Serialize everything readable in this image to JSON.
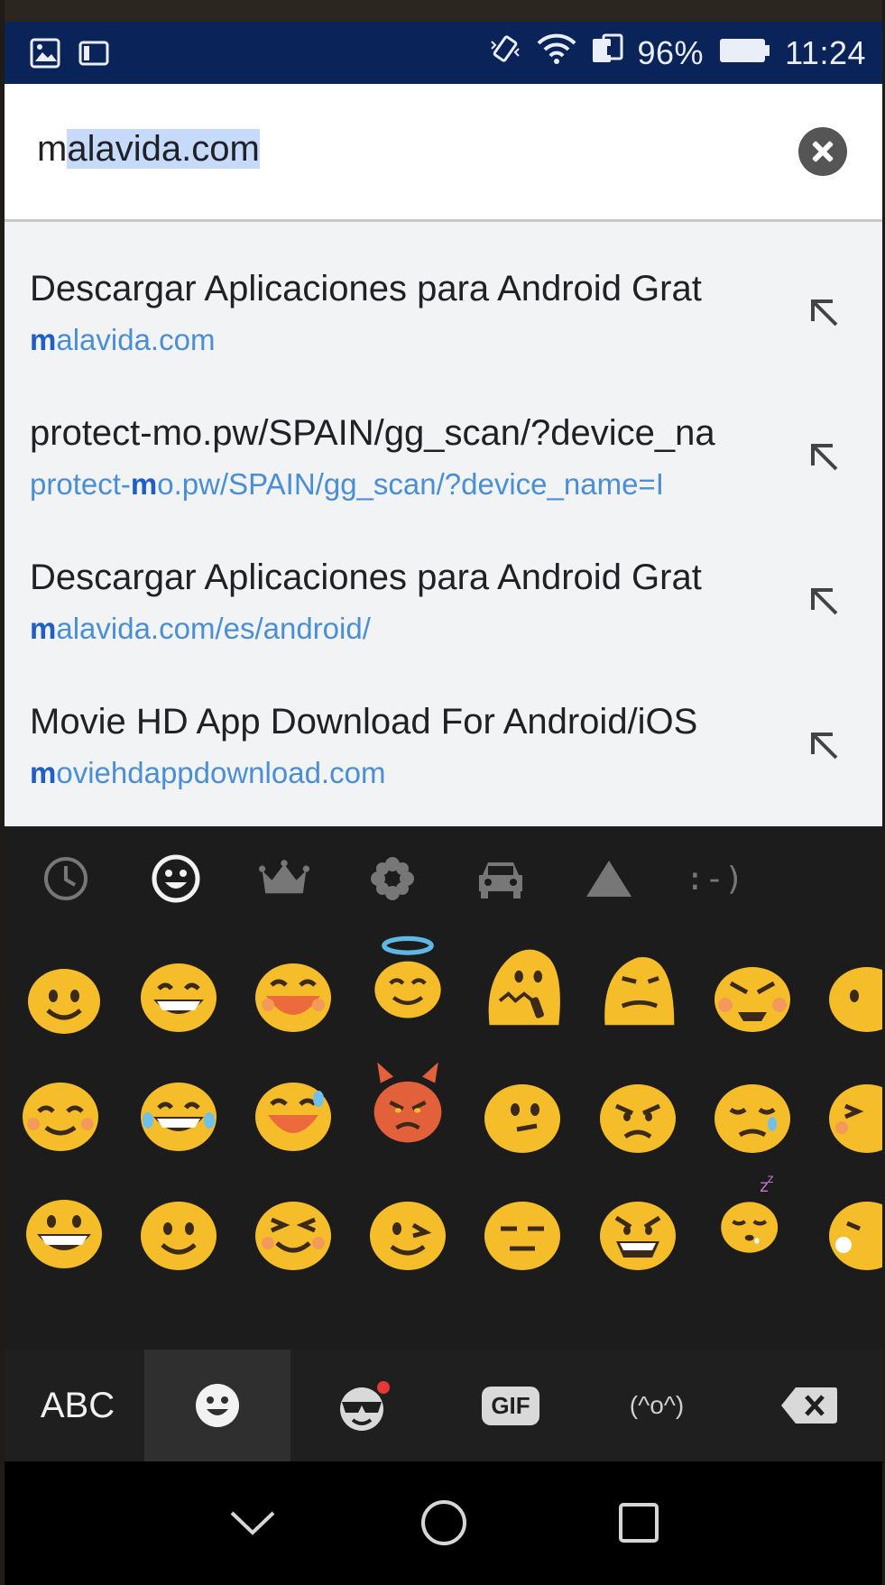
{
  "status_bar": {
    "battery": "96%",
    "time": "11:24"
  },
  "search": {
    "url_prefix": "m",
    "url_selected": "alavida.com"
  },
  "suggestions": [
    {
      "title": "Descargar Aplicaciones para Android Grat",
      "url_bold": "m",
      "url_rest": "alavida.com",
      "url_before": ""
    },
    {
      "title": "protect-mo.pw/SPAIN/gg_scan/?device_na",
      "url_before": "protect-",
      "url_bold": "m",
      "url_rest": "o.pw/SPAIN/gg_scan/?device_name=I"
    },
    {
      "title": "Descargar Aplicaciones para Android Grat",
      "url_before": "",
      "url_bold": "m",
      "url_rest": "alavida.com/es/android/"
    },
    {
      "title": "Movie HD App Download For Android/iOS",
      "url_before": "",
      "url_bold": "m",
      "url_rest": "oviehdappdownload.com"
    }
  ],
  "keyboard": {
    "categories": [
      "recent-icon",
      "smileys-icon",
      "crown-icon",
      "flower-icon",
      "car-icon",
      "triangle-icon",
      "emoticon-text"
    ],
    "emoticon_label": ":-)",
    "bottom": {
      "abc_label": "ABC",
      "gif_label": "GIF",
      "kaomoji_label": "(^o^)"
    },
    "colors": {
      "emoji_yellow": "#f6bd2a",
      "emoji_devil": "#e2603a",
      "panel": "#1c1c1c"
    }
  }
}
